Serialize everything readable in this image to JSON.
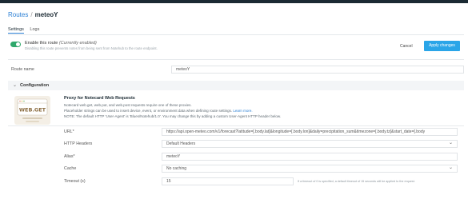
{
  "breadcrumb": {
    "root": "Routes",
    "separator": "/",
    "current": "meteoY"
  },
  "tabs": [
    {
      "label": "Settings",
      "active": true
    },
    {
      "label": "Logs",
      "active": false
    }
  ],
  "enable": {
    "label": "Enable this route",
    "status": "(Currently enabled)",
    "description": "Disabling this route prevents notes from being sent from Notehub to the route endpoint.",
    "on": true
  },
  "actions": {
    "cancel": "Cancel",
    "apply": "Apply changes"
  },
  "route_name": {
    "label": "Route name",
    "value": "meteoY"
  },
  "configuration": {
    "title": "Configuration",
    "logo_text": "WEB.GET",
    "proxy_title": "Proxy for Notecard Web Requests",
    "lines": [
      "Notecard web.get, web.put, and web.post requests require one of these proxies.",
      "Placeholder strings can be used to insert device, event, or environment data when defining route settings.",
      "NOTE: The default HTTP 'User-Agent' is 'Blues/Notehub/1.0'. You may change this by adding a custom User-Agent HTTP header below."
    ],
    "learn_more": "Learn more."
  },
  "fields": {
    "url": {
      "label": "URL*",
      "value": "https://api.open-meteo.com/v1/forecast?latitude=[.body.lat]&longitude=[.body.lon]&daily=precipitation_sum&timezone=[.body.tz]&start_date=[.body"
    },
    "headers": {
      "label": "HTTP Headers",
      "value": "Default Headers"
    },
    "alias": {
      "label": "Alias*",
      "value": "meteoY"
    },
    "cache": {
      "label": "Cache",
      "value": "No caching"
    },
    "timeout": {
      "label": "Timeout (s)",
      "value": "15",
      "hint": "If a timeout of 0 is specified, a default timeout of 15 seconds will be applied to the request."
    }
  },
  "colors": {
    "accent": "#2aa5e8",
    "toggle_on": "#2ea86b",
    "link": "#2a7fd4"
  }
}
